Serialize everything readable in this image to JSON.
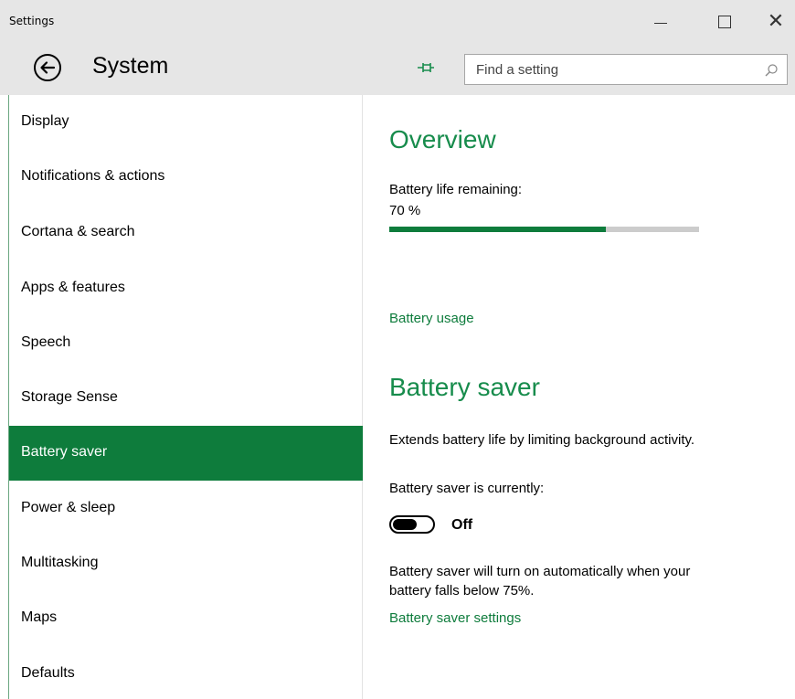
{
  "window": {
    "title": "Settings"
  },
  "header": {
    "title": "System",
    "search_placeholder": "Find a setting"
  },
  "sidebar": {
    "items": [
      {
        "label": "Display",
        "selected": false
      },
      {
        "label": "Notifications & actions",
        "selected": false
      },
      {
        "label": "Cortana & search",
        "selected": false
      },
      {
        "label": "Apps & features",
        "selected": false
      },
      {
        "label": "Speech",
        "selected": false
      },
      {
        "label": "Storage Sense",
        "selected": false
      },
      {
        "label": "Battery saver",
        "selected": true
      },
      {
        "label": "Power & sleep",
        "selected": false
      },
      {
        "label": "Multitasking",
        "selected": false
      },
      {
        "label": "Maps",
        "selected": false
      },
      {
        "label": "Defaults",
        "selected": false
      }
    ]
  },
  "overview": {
    "heading": "Overview",
    "battery_label": "Battery life remaining:",
    "battery_value": "70 %",
    "battery_fraction": 0.7,
    "usage_link": "Battery usage"
  },
  "battery_saver": {
    "heading": "Battery saver",
    "description": "Extends battery life by limiting background activity.",
    "status_label": "Battery saver is currently:",
    "toggle_state": "Off",
    "auto_text_line1": "Battery saver will turn on automatically when your",
    "auto_text_line2": "battery falls below 75%.",
    "settings_link": "Battery saver settings"
  },
  "colors": {
    "accent": "#0e7c3c",
    "heading": "#178c4c",
    "chrome": "#e6e6e6"
  },
  "icons": {
    "back": "back-arrow-circle-icon",
    "pin": "pin-icon",
    "search": "search-icon",
    "minimize": "minimize-icon",
    "maximize": "maximize-icon",
    "close": "close-icon"
  }
}
